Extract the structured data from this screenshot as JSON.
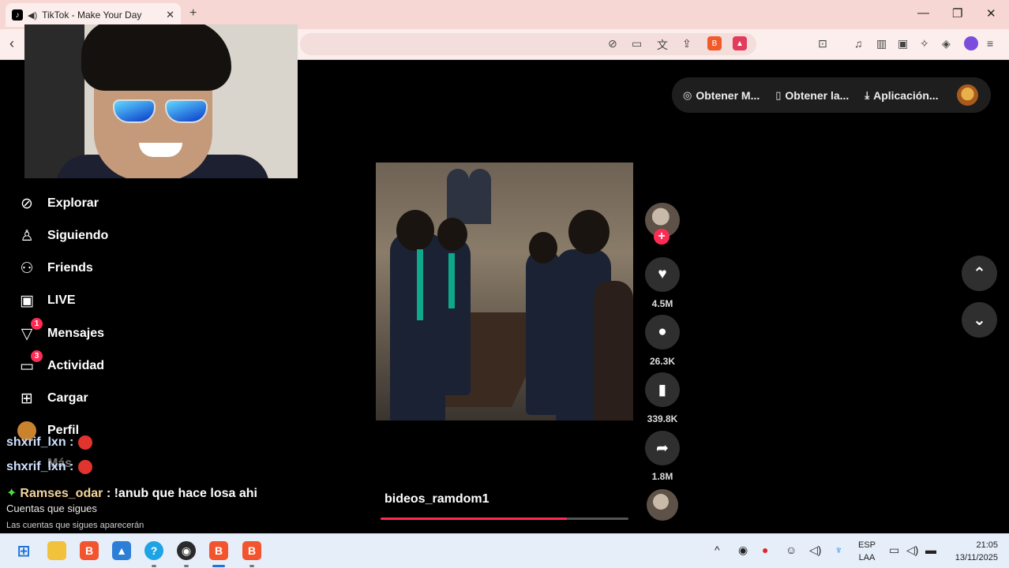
{
  "browser": {
    "tab_title": "TikTok - Make Your Day",
    "tab_icon": "tiktok-icon",
    "new_tab_label": "+",
    "window_controls": {
      "minimize": "—",
      "maximize": "❐",
      "close": "✕"
    }
  },
  "tiktok": {
    "top_buttons": [
      {
        "label": "Obtener M...",
        "icon": "coin-icon"
      },
      {
        "label": "Obtener la...",
        "icon": "phone-icon"
      },
      {
        "label": "Aplicación...",
        "icon": "download-icon"
      }
    ],
    "nav": [
      {
        "label": "Explorar",
        "icon": "compass-icon"
      },
      {
        "label": "Siguiendo",
        "icon": "user-follow-icon"
      },
      {
        "label": "Friends",
        "icon": "friends-icon"
      },
      {
        "label": "LIVE",
        "icon": "live-icon"
      },
      {
        "label": "Mensajes",
        "icon": "messages-icon",
        "badge": "1"
      },
      {
        "label": "Actividad",
        "icon": "activity-icon",
        "badge": "3"
      },
      {
        "label": "Cargar",
        "icon": "upload-icon"
      },
      {
        "label": "Perfil",
        "icon": "profile-icon"
      },
      {
        "label": "Más",
        "icon": "more-icon"
      }
    ],
    "following_heading": "Cuentas que sigues",
    "following_hint": "Las cuentas que sigues aparecerán",
    "video": {
      "caption": "bideos_ramdom1",
      "progress": 0.75
    },
    "actions": {
      "likes": "4.5M",
      "comments": "26.3K",
      "saves": "339.8K",
      "shares": "1.8M",
      "follow_label": "+"
    }
  },
  "chat": [
    {
      "user": "shxrif_lxn",
      "text": ":"
    },
    {
      "user": "shxrif_lxn",
      "text": ":"
    },
    {
      "user": "Ramses_odar",
      "text": ": !anub que hace losa ahi"
    }
  ],
  "taskbar": {
    "language_top": "ESP",
    "language_bottom": "LAA",
    "time": "21:05",
    "date": "13/11/2025"
  },
  "colors": {
    "tiktok_accent": "#fe2c55",
    "tab_bar": "#f6d7d3",
    "taskbar": "#e6eefa"
  }
}
